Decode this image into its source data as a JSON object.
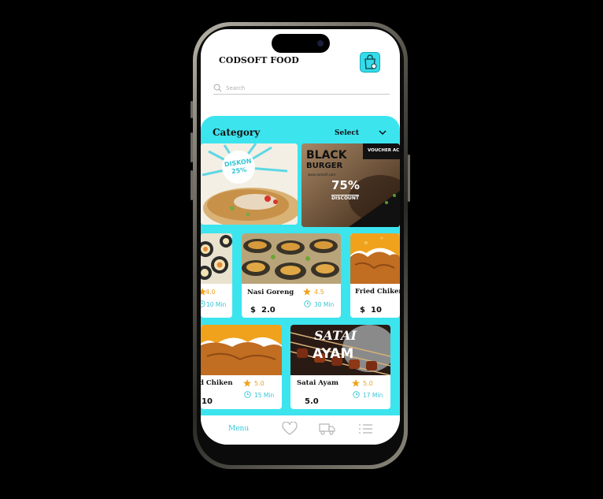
{
  "header": {
    "title": "CODSOFT FOOD",
    "cart_icon": "shopping-bag-icon"
  },
  "search": {
    "placeholder": "Search"
  },
  "category": {
    "label": "Category",
    "select_label": "Select"
  },
  "banners": [
    {
      "name": "discount-banner",
      "badge_line1": "DISKON",
      "badge_line2": "25%"
    },
    {
      "name": "black-burger-banner",
      "voucher": "VOUCHER AC",
      "line1": "BLACK",
      "line2": "BURGER",
      "site": "www.codsoft.com",
      "percent": "75%",
      "discount": "DISCOUNT"
    }
  ],
  "items": [
    {
      "name": "",
      "rating": "4.0",
      "time": "10 Min",
      "price_symbol": "",
      "price": ""
    },
    {
      "name": "Nasi Goreng",
      "rating": "4.5",
      "time": "30 Min",
      "price_symbol": "$",
      "price": "2.0"
    },
    {
      "name": "Fried Chiken",
      "rating": "",
      "time": "",
      "price_symbol": "$",
      "price": "10"
    },
    {
      "name": "d Chiken",
      "rating": "5.0",
      "time": "15 Min",
      "price_symbol": "",
      "price": "10"
    },
    {
      "name": "Satai Ayam",
      "rating": "5.0",
      "time": "17 Min",
      "price_symbol": "",
      "price": "5.0",
      "img_line1": "SATAI",
      "img_line2": "AYAM"
    }
  ],
  "bottom_nav": {
    "menu_label": "Menu",
    "icons": [
      "heart-icon",
      "truck-icon",
      "list-icon"
    ]
  },
  "colors": {
    "accent": "#3ce4ee",
    "star": "#f0a21c",
    "time": "#35c6d6"
  }
}
